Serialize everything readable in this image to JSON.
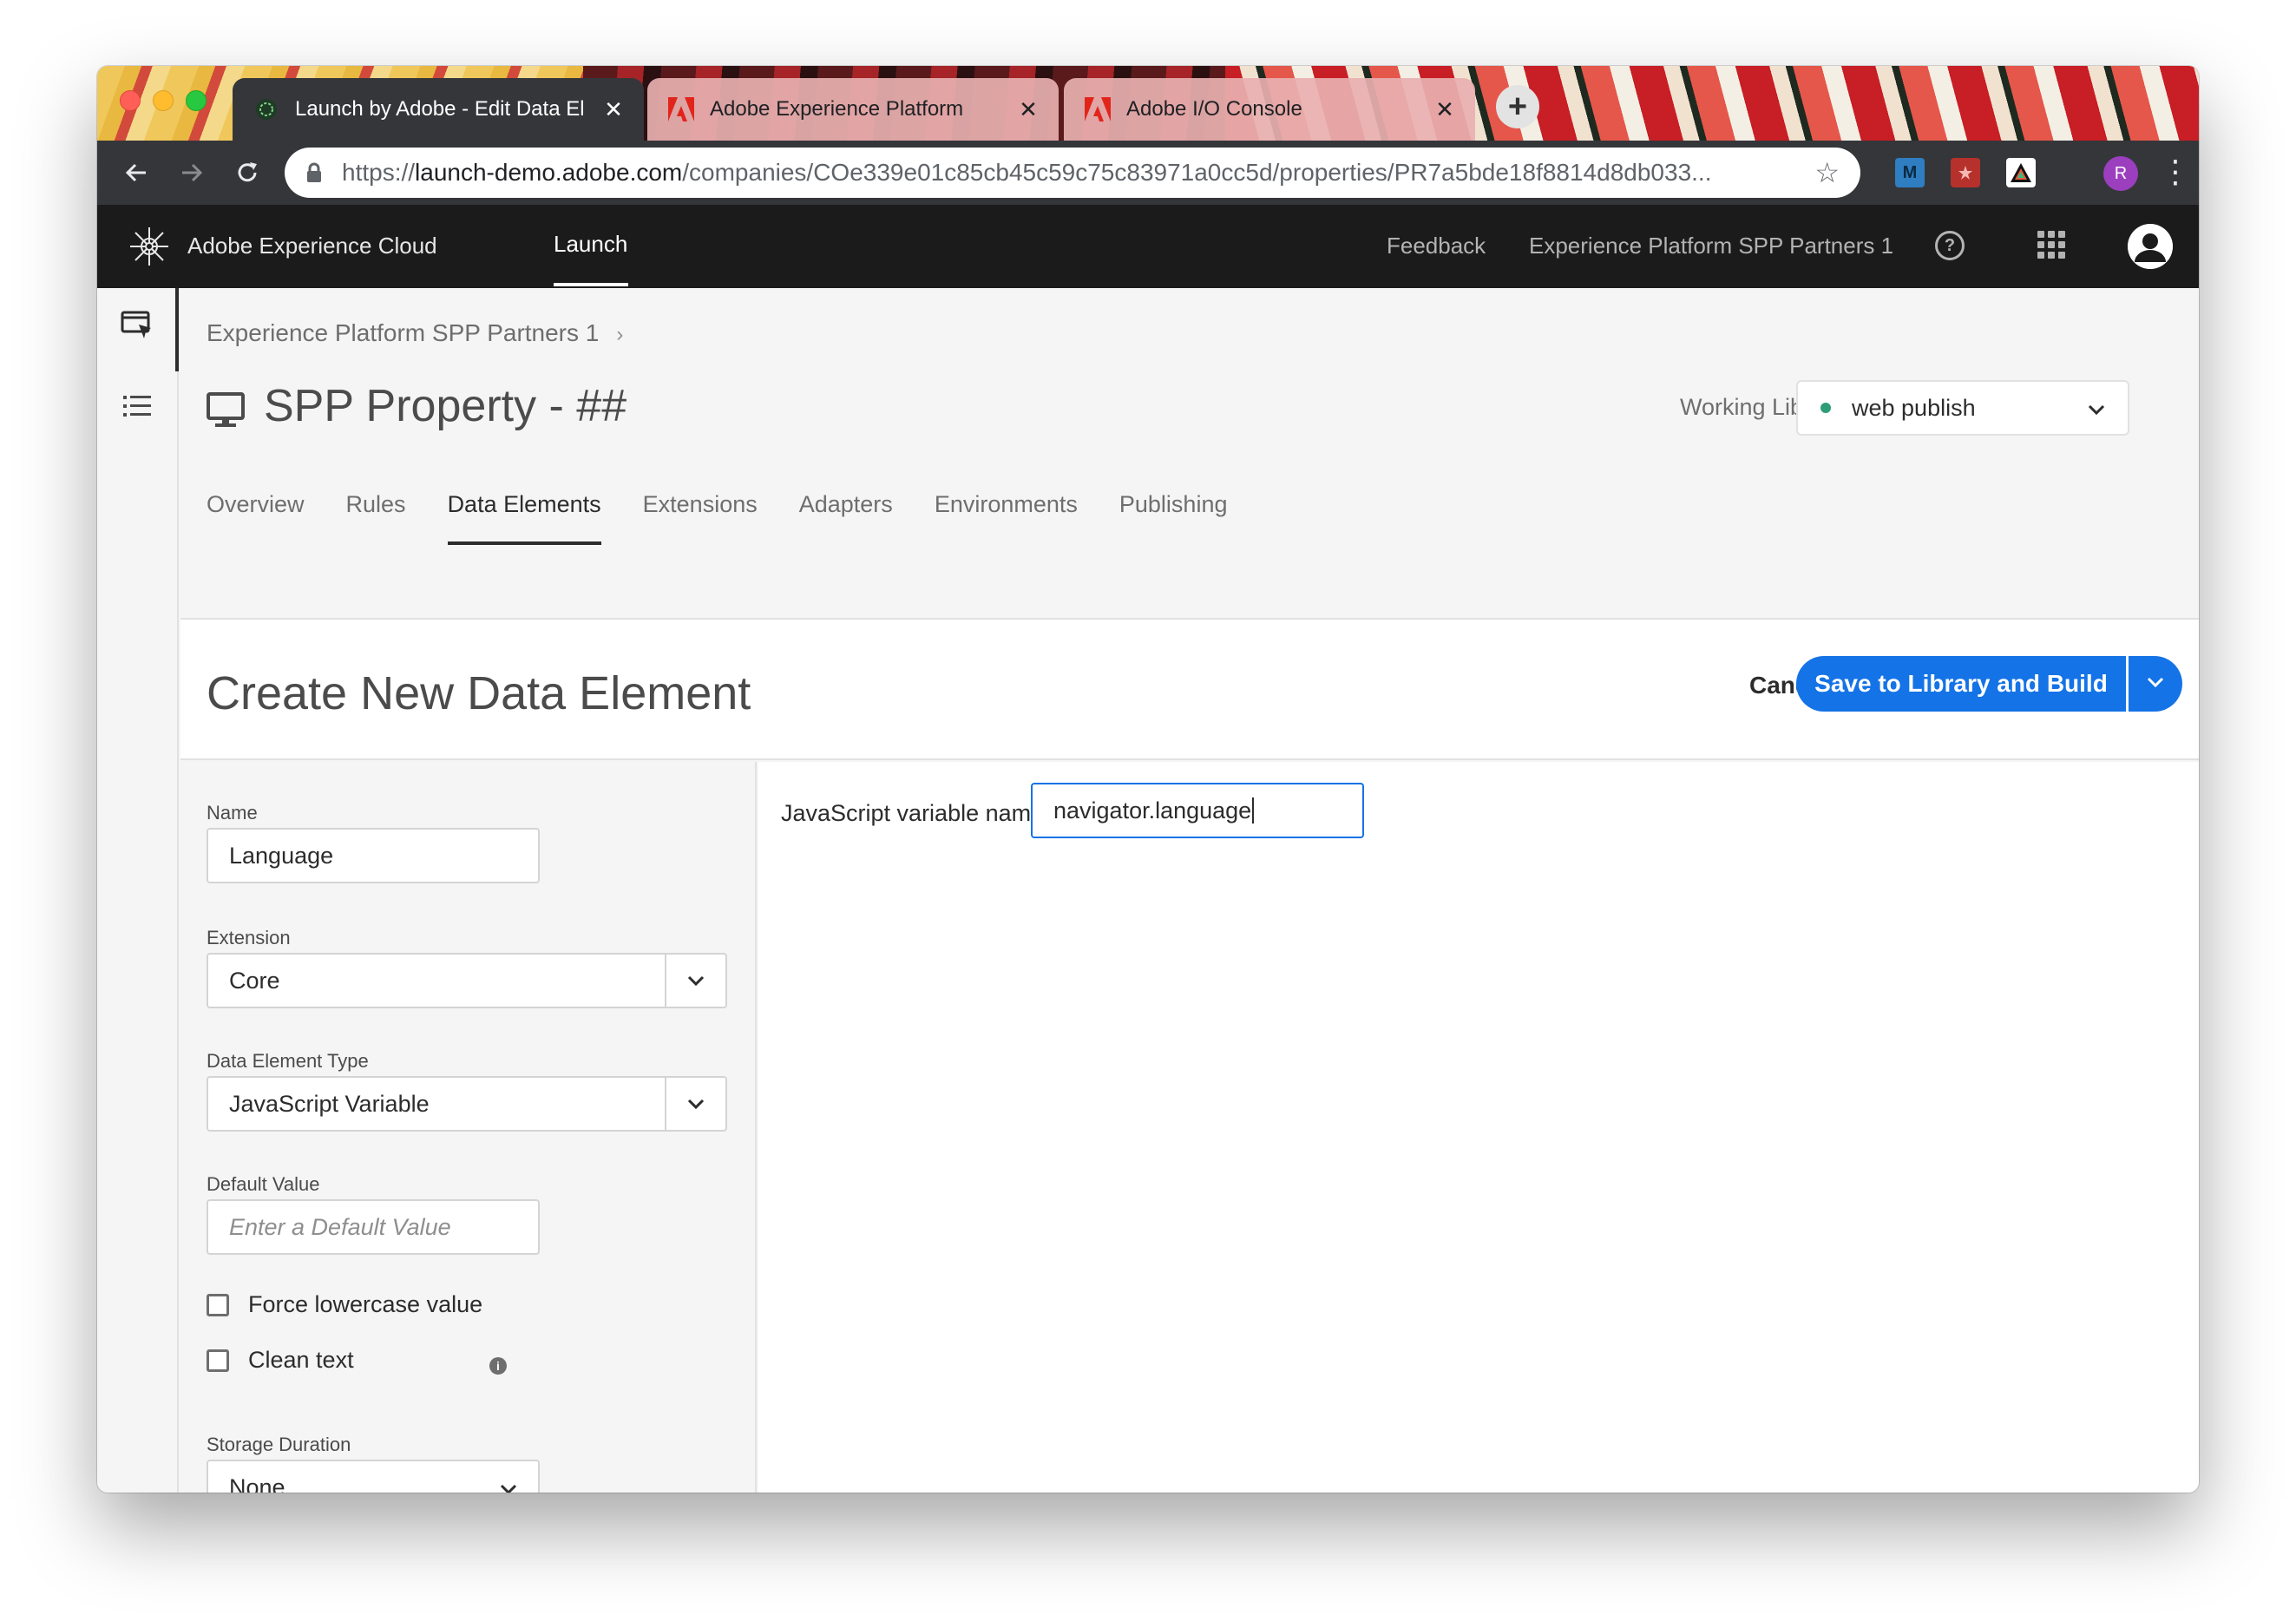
{
  "browser": {
    "tabs": [
      {
        "title": "Launch by Adobe - Edit Data El",
        "icon": "launch-icon",
        "active": true
      },
      {
        "title": "Adobe Experience Platform",
        "icon": "adobe-icon",
        "active": false
      },
      {
        "title": "Adobe I/O Console",
        "icon": "adobe-icon",
        "active": false
      }
    ],
    "url_scheme": "https://",
    "url_host": "launch-demo.adobe.com",
    "url_path": "/companies/COe339e01c85cb45c59c75c83971a0cc5d/properties/PR7a5bde18f8814d8db033...",
    "extensions": [
      "M",
      "",
      ""
    ],
    "profile_initial": "R"
  },
  "header": {
    "brand": "Adobe Experience Cloud",
    "nav_item": "Launch",
    "feedback": "Feedback",
    "org": "Experience Platform SPP Partners 1"
  },
  "breadcrumb": {
    "parent": "Experience Platform SPP Partners 1"
  },
  "property": {
    "title": "SPP Property - ##"
  },
  "working_library": {
    "label": "Working Library:",
    "value": "web publish",
    "status_color": "#2d9d78"
  },
  "tabs": [
    "Overview",
    "Rules",
    "Data Elements",
    "Extensions",
    "Adapters",
    "Environments",
    "Publishing"
  ],
  "selected_tab": "Data Elements",
  "page": {
    "title": "Create New Data Element",
    "cancel": "Cancel",
    "save": "Save to Library and Build"
  },
  "form": {
    "name_label": "Name",
    "name_value": "Language",
    "extension_label": "Extension",
    "extension_value": "Core",
    "type_label": "Data Element Type",
    "type_value": "JavaScript Variable",
    "default_label": "Default Value",
    "default_placeholder": "Enter a Default Value",
    "force_lowercase": "Force lowercase value",
    "clean_text": "Clean text",
    "storage_label": "Storage Duration",
    "storage_value": "None"
  },
  "settings": {
    "js_var_label": "JavaScript variable name",
    "js_var_value": "navigator.language"
  },
  "colors": {
    "accent": "#1473e6",
    "header_bg": "#1b1b1b"
  }
}
